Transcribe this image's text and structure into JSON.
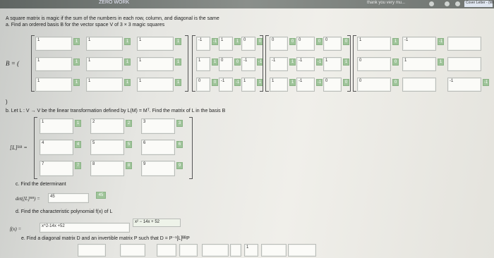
{
  "window": {
    "title": "ZERO WORK",
    "right_text": "thank you very mu...",
    "tab_label": "Cover Letter - (Wind..."
  },
  "question": {
    "intro": "A square matrix is magic if the sum of the numbers in each row, column, and diagonal is the same",
    "a": "a. Find an ordered basis B for the vector space V of 3 × 3 magic squares",
    "b_label": "B = (",
    "b": "b. Let L : V → V be the linear transformation defined by L(M) = Mᵀ. Find the matrix of L in the basis B",
    "lb_label": "[L]ᴮᴮ =",
    "c": "c. Find the determinant",
    "det_label": "det([L]ᴮᴮ) =",
    "det_value": "45",
    "det_check": "45",
    "d": "d. Find the characteristic polynomial f(x) of L",
    "fx_label": "f(x) =",
    "fx_value": "x^2-14x +52",
    "fx_rendered": "x² − 14x + 52",
    "e": "e. Find a diagonal matrix D and an invertible matrix P such that D = P⁻¹[L]ᴮᴮP",
    "paren": ")"
  },
  "basis_matrices": [
    {
      "cells": [
        "1",
        "1",
        "1",
        "1",
        "1",
        "1",
        "1",
        "1",
        "1"
      ],
      "checks": [
        "1",
        "1",
        "1",
        "1",
        "1",
        "1",
        "1",
        "1",
        "1"
      ]
    },
    {
      "cells": [
        "-1",
        "1",
        "0",
        "1",
        "0",
        "-1",
        "0",
        "-1",
        "1"
      ],
      "checks": [
        "-1",
        "1",
        "0",
        "1",
        "0",
        "-1",
        "0",
        "-1",
        "1"
      ]
    },
    {
      "cells": [
        "0",
        "0",
        "0",
        "-1",
        "-1",
        "1",
        "1",
        "-1",
        "0"
      ],
      "checks": [
        "0",
        "0",
        "0",
        "1",
        "-1",
        "1",
        "1",
        "-1",
        "0"
      ]
    },
    {
      "cells": [
        "1",
        "-1",
        "",
        "0",
        "1",
        "",
        "0",
        "",
        "-1"
      ],
      "checks": [
        "1",
        "-1",
        "",
        "0",
        "1",
        "",
        "0",
        "",
        "-1"
      ]
    }
  ],
  "lb_matrix": {
    "cells": [
      "1",
      "2",
      "3",
      "4",
      "5",
      "6",
      "7",
      "8",
      "9"
    ],
    "checks": [
      "1",
      "2",
      "3",
      "4",
      "5",
      "6",
      "7",
      "8",
      "9"
    ]
  },
  "e_row_boxes": [
    "",
    "",
    "",
    "",
    "",
    "",
    "1",
    "",
    ""
  ]
}
